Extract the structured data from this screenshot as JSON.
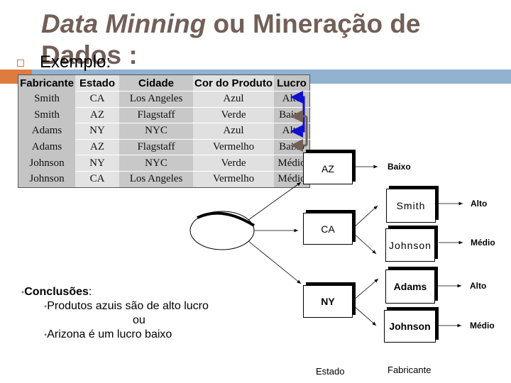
{
  "slide": {
    "title_italic": "Data Minning",
    "title_rest": " ou Mineração de Dados :",
    "bullet": "Exemplo:"
  },
  "colors": {
    "title": "#725f57",
    "accent_orange": "#e07b40",
    "accent_blue": "#91b2d0",
    "bracket_blue": "#1010d0",
    "bracket_brown": "#725f57"
  },
  "table": {
    "headers": [
      "Fabricante",
      "Estado",
      "Cidade",
      "Cor do Produto",
      "Lucro"
    ],
    "rows": [
      [
        "Smith",
        "CA",
        "Los Angeles",
        "Azul",
        "Alto"
      ],
      [
        "Smith",
        "AZ",
        "Flagstaff",
        "Verde",
        "Baixo"
      ],
      [
        "Adams",
        "NY",
        "NYC",
        "Azul",
        "Alto"
      ],
      [
        "Adams",
        "AZ",
        "Flagstaff",
        "Vermelho",
        "Baixo"
      ],
      [
        "Johnson",
        "NY",
        "NYC",
        "Verde",
        "Médio"
      ],
      [
        "Johnson",
        "CA",
        "Los Angeles",
        "Vermelho",
        "Médio"
      ]
    ]
  },
  "tree": {
    "root": "",
    "estados": [
      "AZ",
      "CA",
      "NY"
    ],
    "az_result": "Baixo",
    "ca_fabricantes": [
      "Smith",
      "Johnson"
    ],
    "ca_results": [
      "Alto",
      "Médio"
    ],
    "ny_fabricantes": [
      "Adams",
      "Johnson"
    ],
    "ny_results": [
      "Alto",
      "Médio"
    ],
    "level_labels": [
      "Estado",
      "Fabricante"
    ]
  },
  "conclusions": {
    "heading": "Conclusões",
    "colon": ":",
    "item1": "Produtos azuis são de alto lucro",
    "or": "ou",
    "item2": "Arizona é um lucro baixo"
  }
}
